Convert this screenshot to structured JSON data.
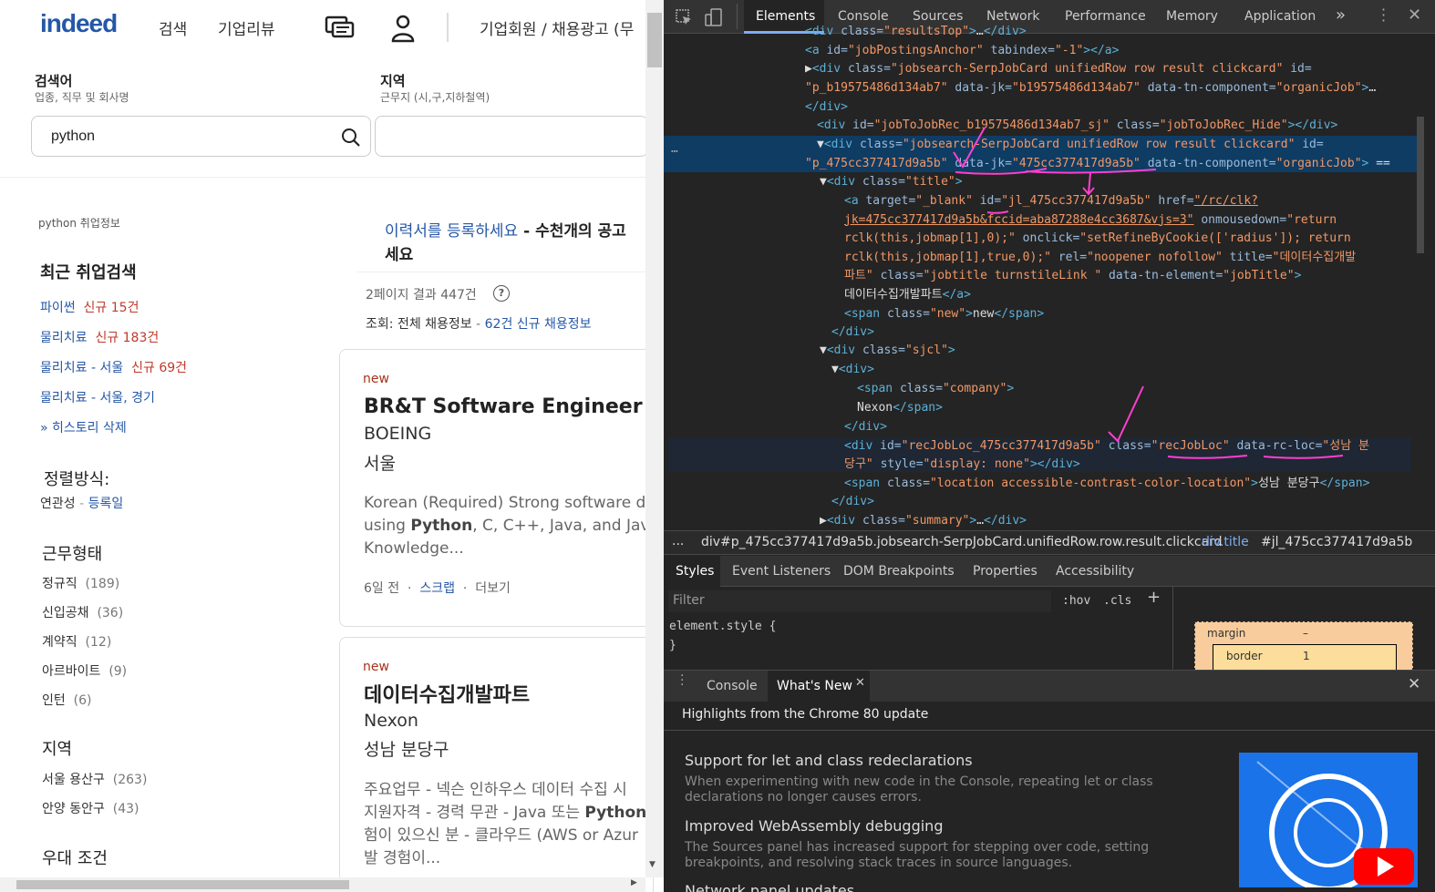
{
  "left": {
    "logo": "indeed",
    "nav": {
      "search": "검색",
      "reviews": "기업리뷰",
      "employer": "기업회원 / 채용광고 (무"
    },
    "search": {
      "what_label": "검색어",
      "what_sub": "업종, 직무 및 회사명",
      "what_value": "python",
      "where_label": "지역",
      "where_sub": "근무지 (시,구,지하철역)"
    },
    "sidebar": {
      "crumb": "python 취업정보",
      "recent_title": "최근 취업검색",
      "recent": [
        {
          "label": "파이썬",
          "new": "신규 15건"
        },
        {
          "label": "물리치료",
          "new": "신규 183건"
        },
        {
          "label": "물리치료 - 서울",
          "new": "신규 69건"
        },
        {
          "label": "물리치료 - 서울, 경기",
          "new": ""
        }
      ],
      "history_delete": "» 히스토리 삭제",
      "sort_title": "정렬방식:",
      "sort_current": "연관성",
      "sort_dash": "-",
      "sort_alt": "등록일",
      "jobtype_title": "근무형태",
      "jobtypes": [
        {
          "label": "정규직",
          "count": "(189)"
        },
        {
          "label": "신입공채",
          "count": "(36)"
        },
        {
          "label": "계약직",
          "count": "(12)"
        },
        {
          "label": "아르바이트",
          "count": "(9)"
        },
        {
          "label": "인턴",
          "count": "(6)"
        }
      ],
      "region_title": "지역",
      "regions": [
        {
          "label": "서울 용산구",
          "count": "(263)"
        },
        {
          "label": "안양 동안구",
          "count": "(43)"
        }
      ],
      "benefit_title": "우대 조건"
    },
    "main": {
      "resume_link": "이력서를 등록하세요",
      "resume_rest": " - 수천개의 공고",
      "resume_rest2": "세요",
      "results": "2페이지 결과 447건",
      "view_label": "조회:",
      "view_all": "전체 채용정보",
      "view_dash": "-",
      "view_new": "62건 신규 채용정보",
      "jobs": [
        {
          "tag": "new",
          "title": "BR&T Software Engineer Inter",
          "company": "BOEING",
          "location": "서울",
          "snippet1": "Korean (Required) Strong software de",
          "snippet2a": "using ",
          "snippet2b": "Python",
          "snippet2c": ", C, C++, Java, and Javascr",
          "snippet3": "Knowledge...",
          "age": "6일 전",
          "save": "스크랩",
          "more": "더보기"
        },
        {
          "tag": "new",
          "title": "데이터수집개발파트",
          "company": "Nexon",
          "location": "성남 분당구",
          "snippet1": "주요업무 - 넥슨 인하우스 데이터 수집 시",
          "snippet2a": "지원자격 - 경력 무관 - Java 또는 ",
          "snippet2b": "Python",
          "snippet2c": "",
          "snippet3": "험이 있으신 분 - 클라우드 (AWS or Azur",
          "snippet4": "발 경험이..."
        }
      ]
    }
  },
  "devtools": {
    "tabs": [
      "Elements",
      "Console",
      "Sources",
      "Network",
      "Performance",
      "Memory",
      "Application"
    ],
    "more_tabs": "»",
    "breadcrumb": {
      "more": "...",
      "item1": "div#p_475cc377417d9a5b.jobsearch-SerpJobCard.unifiedRow.row.result.clickcard",
      "item2": "div.title",
      "item3": "#jl_475cc377417d9a5b"
    },
    "styles_tabs": [
      "Styles",
      "Event Listeners",
      "DOM Breakpoints",
      "Properties",
      "Accessibility"
    ],
    "filter_placeholder": "Filter",
    "hov": ":hov",
    "cls": ".cls",
    "plus": "+",
    "element_style": "element.style {",
    "element_style_close": "}",
    "box": {
      "margin": "margin",
      "margin_val": "–",
      "border": "border",
      "border_val": "1"
    },
    "drawer_tabs": [
      "Console",
      "What's New"
    ],
    "whatsnew_header": "Highlights from the Chrome 80 update",
    "news": [
      {
        "title": "Support for let and class redeclarations",
        "desc1": "When experimenting with new code in the Console, repeating let or class",
        "desc2": "declarations no longer causes errors."
      },
      {
        "title": "Improved WebAssembly debugging",
        "desc1": "The Sources panel has increased support for stepping over code, setting",
        "desc2": "breakpoints, and resolving stack traces in source languages."
      }
    ],
    "news_partial": "Network panel updates",
    "colors": {
      "tag": "#5db0d7",
      "attr_name": "#9bbbdc",
      "attr_value": "#f29766",
      "annotation": "#ff3fd0"
    }
  }
}
